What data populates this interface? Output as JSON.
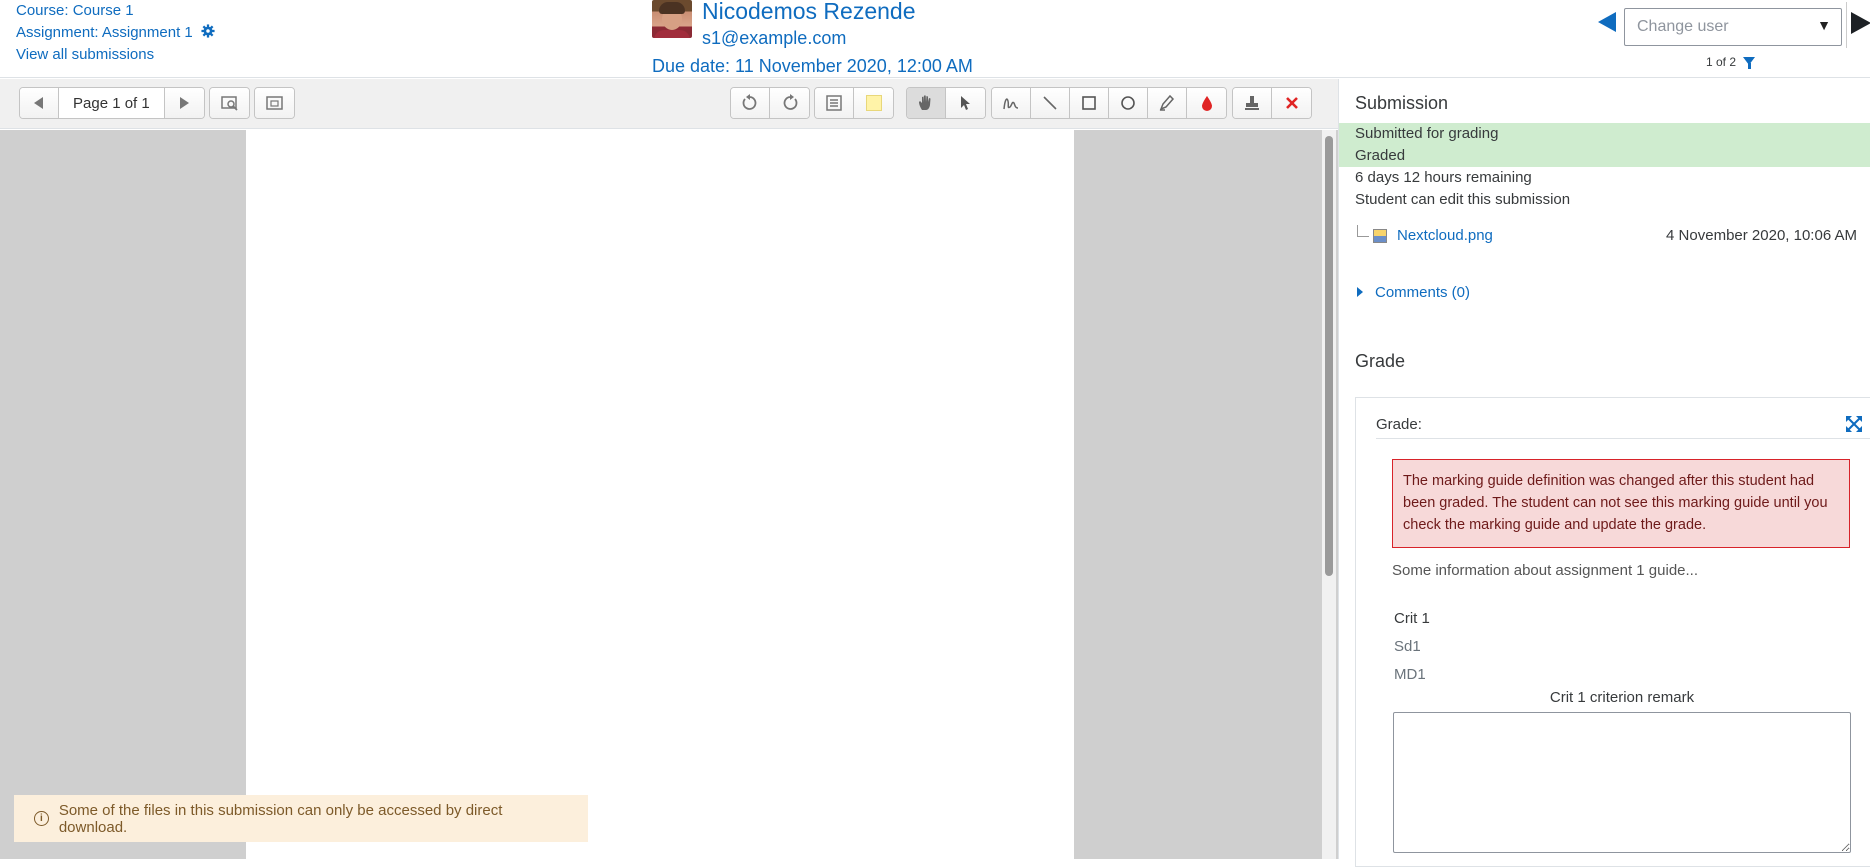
{
  "header": {
    "course_link": "Course: Course 1",
    "assignment_link": "Assignment: Assignment 1",
    "view_all": "View all submissions",
    "user_name": "Nicodemos Rezende",
    "user_email": "s1@example.com",
    "due_date": "Due date: 11 November 2020, 12:00 AM",
    "change_user_placeholder": "Change user",
    "count": "1 of 2"
  },
  "toolbar": {
    "page_label": "Page 1 of 1",
    "icons": [
      "prev-page-icon",
      "next-page-icon",
      "search-comments-icon",
      "expand-comments-icon",
      "rotate-left-icon",
      "rotate-right-icon",
      "comment-icon",
      "color-swatch-icon",
      "pan-icon",
      "select-icon",
      "pen-icon",
      "line-icon",
      "rectangle-icon",
      "oval-icon",
      "highlight-icon",
      "color-drop-icon",
      "stamp-icon",
      "delete-icon"
    ],
    "colors": {
      "swatch": "#fff3a8",
      "drop": "#e02424",
      "delete": "#e02424"
    }
  },
  "editor": {
    "notice": "Some of the files in this submission can only be accessed by direct download."
  },
  "panel": {
    "submission_title": "Submission",
    "status_submitted": "Submitted for grading",
    "status_graded": "Graded",
    "time_remaining": "6 days 12 hours remaining",
    "can_edit": "Student can edit this submission",
    "file_name": "Nextcloud.png",
    "file_date": "4 November 2020, 10:06 AM",
    "comments": "Comments (0)",
    "grade_title": "Grade",
    "grade_label": "Grade:",
    "alert": "The marking guide definition was changed after this student had been graded. The student can not see this marking guide until you check the marking guide and update the grade.",
    "guide_info": "Some information about assignment 1 guide...",
    "criterion_name": "Crit 1",
    "criterion_desc": "Sd1",
    "criterion_max": "MD1",
    "remark_label": "Crit 1 criterion remark",
    "remark_value": ""
  }
}
